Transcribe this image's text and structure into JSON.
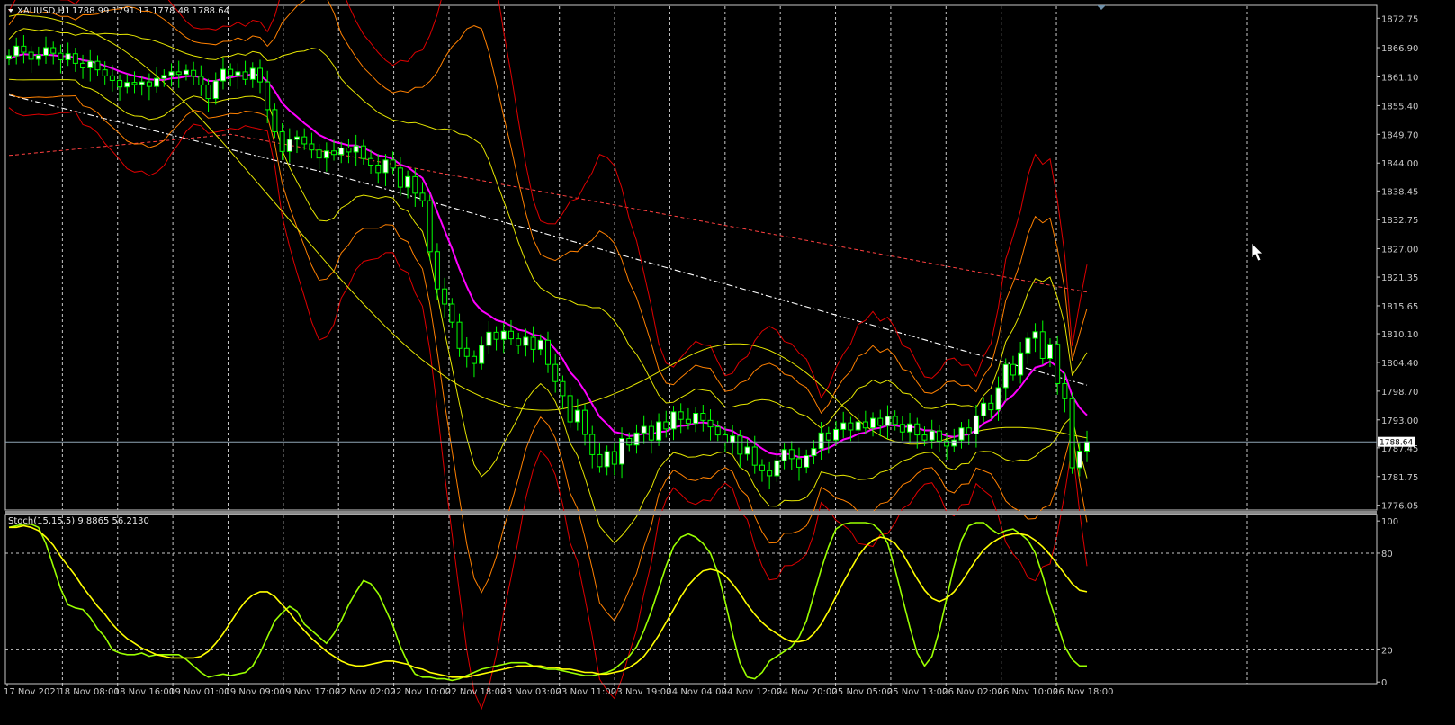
{
  "header": {
    "symbol": "XAUUSD,H1",
    "ohlc": "1788.99 1791.13 1778.48 1788.64",
    "indicator": "Stoch(15,15,5) 9.8865 56.2130"
  },
  "colors": {
    "background": "#000000",
    "grid": "#c8c8c8",
    "text": "#c8c8c8",
    "bull_candle": "#ffffff",
    "candle_outline": "#00ff00",
    "ma": "#ff00ff",
    "bands_yellow": "#e6e600",
    "bands_orange": "#ff8000",
    "bands_red": "#e00000",
    "ma_slow": "#ffffff",
    "ma_slow_red": "#ff4040",
    "stoch_main": "#9aff00",
    "stoch_signal": "#ffff00",
    "current_price_line": "#8fa5b5",
    "price_tag_bg": "#ffffff",
    "price_tag_text": "#000000"
  },
  "chart_data": [
    {
      "type": "candlestick",
      "title": "XAUUSD,H1",
      "yticks": [
        1872.75,
        1866.9,
        1861.1,
        1855.4,
        1849.7,
        1844.0,
        1838.45,
        1832.75,
        1827.0,
        1821.35,
        1815.65,
        1810.1,
        1804.4,
        1798.7,
        1793.0,
        1787.45,
        1781.75,
        1776.05
      ],
      "ylim": [
        1775.1,
        1875.3
      ],
      "current_price": "1788.64",
      "xticks": [
        "17 Nov 2021",
        "18 Nov 08:00",
        "18 Nov 16:00",
        "19 Nov 01:00",
        "19 Nov 09:00",
        "19 Nov 17:00",
        "22 Nov 02:00",
        "22 Nov 10:00",
        "22 Nov 18:00",
        "23 Nov 03:00",
        "23 Nov 11:00",
        "23 Nov 19:00",
        "24 Nov 04:00",
        "24 Nov 12:00",
        "24 Nov 20:00",
        "25 Nov 05:00",
        "25 Nov 13:00",
        "26 Nov 02:00",
        "26 Nov 10:00",
        "26 Nov 18:00"
      ],
      "close": [
        1865.3,
        1867.2,
        1866.0,
        1864.6,
        1865.4,
        1866.9,
        1865.8,
        1864.5,
        1865.7,
        1863.8,
        1862.9,
        1864.2,
        1862.5,
        1861.3,
        1860.4,
        1859.1,
        1860.0,
        1859.6,
        1860.1,
        1859.2,
        1860.8,
        1861.4,
        1862.1,
        1861.6,
        1862.4,
        1861.2,
        1859.5,
        1856.8,
        1860.3,
        1862.6,
        1861.4,
        1862.1,
        1860.6,
        1862.8,
        1860.1,
        1854.6,
        1850.2,
        1846.3,
        1848.7,
        1849.2,
        1847.8,
        1846.6,
        1845.0,
        1846.4,
        1845.7,
        1847.0,
        1846.2,
        1847.4,
        1844.9,
        1843.6,
        1842.1,
        1844.6,
        1843.0,
        1839.2,
        1841.3,
        1838.0,
        1836.5,
        1826.4,
        1819.0,
        1816.0,
        1812.4,
        1807.2,
        1805.6,
        1804.2,
        1807.8,
        1810.4,
        1809.0,
        1810.6,
        1809.1,
        1807.8,
        1809.4,
        1807.0,
        1808.8,
        1804.0,
        1800.6,
        1797.8,
        1792.6,
        1794.9,
        1790.1,
        1786.1,
        1783.7,
        1786.7,
        1784.2,
        1789.3,
        1788.0,
        1790.4,
        1791.7,
        1789.0,
        1792.6,
        1791.2,
        1794.6,
        1793.1,
        1792.3,
        1794.3,
        1792.9,
        1791.6,
        1790.0,
        1788.4,
        1789.8,
        1786.2,
        1787.6,
        1784.0,
        1782.9,
        1781.9,
        1784.9,
        1787.1,
        1785.3,
        1783.6,
        1785.9,
        1787.3,
        1790.4,
        1789.0,
        1791.1,
        1792.4,
        1791.0,
        1792.6,
        1791.4,
        1793.3,
        1791.9,
        1793.7,
        1792.1,
        1790.6,
        1792.2,
        1790.0,
        1789.0,
        1790.8,
        1788.8,
        1787.8,
        1789.0,
        1791.4,
        1790.2,
        1793.8,
        1796.3,
        1795.0,
        1799.4,
        1804.0,
        1801.9,
        1806.3,
        1809.2,
        1810.5,
        1805.2,
        1808.0,
        1800.2,
        1797.2,
        1783.5,
        1786.8,
        1788.64
      ],
      "series": [
        {
          "name": "",
          "kind": "line",
          "color": "#ff00ff",
          "values": [
            1864.6,
            1865.3,
            1865.6,
            1865.5,
            1865.4,
            1865.5,
            1865.4,
            1865.2,
            1865.2,
            1864.9,
            1864.4,
            1864.2,
            1863.8,
            1863.3,
            1862.8,
            1862.2,
            1861.7,
            1861.3,
            1861.0,
            1860.6,
            1860.5,
            1860.5,
            1860.8,
            1860.9,
            1861.2,
            1861.3,
            1861.0,
            1860.3,
            1860.3,
            1860.8,
            1861.0,
            1861.3,
            1861.3,
            1861.7,
            1861.4,
            1860.2,
            1858.3,
            1855.9,
            1854.4,
            1853.2,
            1851.9,
            1850.8,
            1849.6,
            1848.9,
            1848.2,
            1847.9,
            1847.5,
            1847.5,
            1847.0,
            1846.3,
            1845.5,
            1845.3,
            1844.8,
            1843.7,
            1843.2,
            1842.1,
            1841.0,
            1838.1,
            1834.3,
            1830.6,
            1827.0,
            1823.0,
            1819.5,
            1816.4,
            1814.7,
            1813.8,
            1812.8,
            1812.4,
            1811.7,
            1810.9,
            1810.6,
            1809.9,
            1809.7,
            1808.6,
            1807.0,
            1805.1,
            1802.5,
            1800.9,
            1798.7,
            1796.1,
            1793.6,
            1792.2,
            1790.6,
            1790.3,
            1789.8,
            1789.9,
            1790.3,
            1790.1,
            1790.6,
            1790.7,
            1791.5,
            1791.8,
            1791.9,
            1792.4,
            1792.5,
            1792.3,
            1791.8,
            1791.1,
            1790.8,
            1789.8,
            1789.4,
            1788.3,
            1787.3,
            1786.4,
            1786.1,
            1786.3,
            1786.1,
            1785.6,
            1785.7,
            1786.0,
            1787.0,
            1787.4,
            1788.2,
            1789.1,
            1789.5,
            1790.2,
            1790.5,
            1791.2,
            1791.4,
            1791.9,
            1791.9,
            1791.6,
            1791.7,
            1791.4,
            1790.9,
            1790.9,
            1790.4,
            1789.8,
            1789.6,
            1790.0,
            1790.1,
            1791.0,
            1792.3,
            1793.0,
            1794.6,
            1796.8,
            1797.9,
            1799.6,
            1801.6,
            1803.4,
            1803.8,
            1804.6,
            1803.5,
            1802.1,
            1797.8,
            1795.4,
            1793.9
          ]
        },
        {
          "name": "",
          "kind": "line",
          "color": "#e6e600",
          "values": [
            1873.1,
            1873.4,
            1873.4,
            1873.2,
            1873.1,
            1872.9,
            1872.6,
            1872.2,
            1871.8,
            1871.3,
            1870.7,
            1870.1,
            1869.4,
            1868.6,
            1867.8,
            1866.9,
            1865.9,
            1864.8,
            1863.7,
            1862.5,
            1861.3,
            1860.0,
            1858.6,
            1857.2,
            1855.8,
            1854.3,
            1852.8,
            1851.2,
            1849.6,
            1848.0,
            1846.3,
            1844.6,
            1842.9,
            1841.2,
            1839.5,
            1837.8,
            1836.1,
            1834.4,
            1832.7,
            1831.0,
            1829.3,
            1827.6,
            1825.9,
            1824.2,
            1822.5,
            1820.8,
            1819.2,
            1817.6,
            1816.0,
            1814.5,
            1813.0,
            1811.5,
            1810.1,
            1808.7,
            1807.4,
            1806.1,
            1804.9,
            1803.8,
            1802.7,
            1801.7,
            1800.7,
            1799.8,
            1799.0,
            1798.3,
            1797.6,
            1797.0,
            1796.5,
            1796.0,
            1795.6,
            1795.3,
            1795.1,
            1795.0,
            1794.9,
            1794.9,
            1795.0,
            1795.2,
            1795.5,
            1795.8,
            1796.2,
            1796.6,
            1797.1,
            1797.6,
            1798.2,
            1798.8,
            1799.5,
            1800.2,
            1800.9,
            1801.7,
            1802.5,
            1803.3,
            1804.1,
            1804.9,
            1805.6,
            1806.3,
            1806.9,
            1807.4,
            1807.7,
            1808.0,
            1808.1,
            1808.1,
            1808.0,
            1807.7,
            1807.3,
            1806.8,
            1806.1,
            1805.3,
            1804.4,
            1803.4,
            1802.3,
            1801.1,
            1799.8,
            1798.5,
            1797.1,
            1795.7,
            1794.3,
            1793.0,
            1791.8,
            1790.8,
            1789.9,
            1789.2,
            1788.7,
            1788.4,
            1788.2,
            1788.2,
            1788.3,
            1788.5,
            1788.8,
            1789.2,
            1789.6,
            1790.0,
            1790.4,
            1790.7,
            1791.0,
            1791.2,
            1791.4,
            1791.5,
            1791.5,
            1791.5,
            1791.4,
            1791.3,
            1791.1,
            1790.9,
            1790.6,
            1790.3,
            1790.0,
            1789.7,
            1789.4
          ]
        }
      ]
    },
    {
      "type": "line",
      "title": "Stoch(15,15,5) 9.8865 56.2130",
      "yticks": [
        100,
        80,
        20,
        0
      ],
      "levels": [
        80,
        20
      ],
      "ylim": [
        -1,
        104
      ],
      "series": [
        {
          "name": "",
          "color": "#9aff00",
          "values": [
            96,
            97,
            98,
            98,
            96,
            86,
            72,
            58,
            48,
            46,
            45,
            40,
            33,
            28,
            20,
            18,
            17,
            17,
            18,
            16,
            17,
            17,
            17,
            17,
            14,
            10,
            6,
            3,
            4,
            5,
            4,
            5,
            6,
            10,
            18,
            28,
            38,
            43,
            47,
            44,
            36,
            32,
            28,
            24,
            30,
            38,
            48,
            56,
            63,
            61,
            55,
            45,
            35,
            22,
            12,
            5,
            3,
            3,
            2,
            2,
            1,
            2,
            4,
            6,
            8,
            9,
            10,
            11,
            12,
            12,
            12,
            10,
            9,
            8,
            8,
            7,
            6,
            5,
            4,
            4,
            5,
            6,
            8,
            12,
            16,
            22,
            32,
            44,
            58,
            72,
            84,
            90,
            92,
            90,
            86,
            80,
            68,
            50,
            30,
            12,
            3,
            2,
            6,
            13,
            16,
            19,
            22,
            28,
            38,
            54,
            70,
            84,
            95,
            98,
            99,
            99,
            99,
            98,
            94,
            86,
            70,
            52,
            34,
            18,
            10,
            16,
            32,
            52,
            72,
            88,
            97,
            99,
            99,
            95,
            92,
            94,
            95,
            92,
            88,
            80,
            66,
            50,
            36,
            22,
            14,
            10,
            10
          ]
        },
        {
          "name": "",
          "color": "#ffff00",
          "values": [
            96,
            96,
            97,
            96,
            94,
            90,
            85,
            78,
            72,
            66,
            59,
            53,
            47,
            42,
            36,
            31,
            27,
            24,
            21,
            19,
            17,
            16,
            15,
            15,
            15,
            15,
            16,
            19,
            24,
            30,
            37,
            44,
            50,
            54,
            56,
            56,
            53,
            48,
            43,
            37,
            32,
            27,
            23,
            19,
            16,
            13,
            11,
            10,
            10,
            11,
            12,
            13,
            13,
            12,
            11,
            9,
            8,
            6,
            5,
            4,
            3,
            3,
            3,
            4,
            5,
            6,
            7,
            8,
            9,
            10,
            10,
            10,
            10,
            9,
            9,
            8,
            8,
            7,
            6,
            6,
            5,
            5,
            6,
            7,
            9,
            12,
            16,
            22,
            29,
            37,
            45,
            53,
            60,
            65,
            69,
            70,
            69,
            66,
            61,
            55,
            48,
            42,
            37,
            33,
            30,
            27,
            25,
            25,
            26,
            30,
            36,
            44,
            53,
            62,
            70,
            78,
            84,
            88,
            90,
            89,
            86,
            80,
            72,
            64,
            57,
            52,
            50,
            52,
            56,
            62,
            69,
            76,
            82,
            86,
            89,
            91,
            92,
            92,
            91,
            88,
            84,
            79,
            73,
            67,
            61,
            57,
            56
          ]
        }
      ]
    }
  ]
}
